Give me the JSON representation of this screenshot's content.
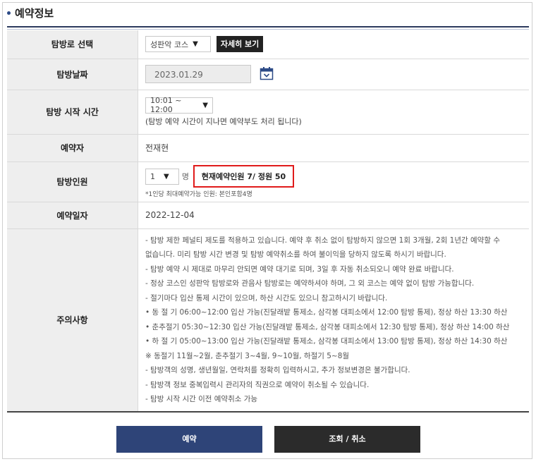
{
  "section_title": "예약정보",
  "rows": {
    "route": {
      "label": "탐방로 선택",
      "select_value": "성판악 코스",
      "detail_button": "자세히 보기"
    },
    "date": {
      "label": "탐방날짜",
      "value": "2023.01.29"
    },
    "start_time": {
      "label": "탐방 시작 시간",
      "select_value": "10:01 ~ 12:00",
      "note": "(탐방 예약 시간이 지나면 예약부도 처리 됩니다)"
    },
    "reserver": {
      "label": "예약자",
      "value": "전재현"
    },
    "people": {
      "label": "탐방인원",
      "select_value": "1",
      "unit": "명",
      "capacity": "현재예약인원 7/ 정원 50",
      "hint": "*1인당 최대예약가능 인원: 본인포함4명"
    },
    "reserve_date": {
      "label": "예약일자",
      "value": "2022-12-04"
    },
    "notes": {
      "label": "주의사항",
      "items": [
        "- 탐방 제한 페널티 제도를 적용하고 있습니다. 예약 후 취소 없이 탐방하지 않으면 1회 3개월, 2회 1년간 예약할 수",
        "  없습니다. 미리 탐방 시간 변경 및 탐방 예약취소를 하여 불이익을 당하지 않도록 하시기 바랍니다.",
        "- 탐방 예약 시 제대로 마무리 안되면 예약 대기로 되며, 3일 후 자동 취소되오니 예약 완료 바랍니다.",
        "- 정상 코스인 성판악 탐방로와 관음사 탐방로는 예약하셔야 하며, 그 외 코스는 예약 없이 탐방 가능합니다.",
        "- 절기마다 입산 통제 시간이 있으며, 하산 시간도 있으니 참고하시기 바랍니다.",
        "  • 동 절 기 06:00~12:00 입산 가능(진달래밭 통제소, 삼각봉 대피소에서 12:00 탐방 통제), 정상 하산 13:30 하산",
        "  • 춘추절기 05:30~12:30 입산 가능(진달래밭 통제소, 삼각봉 대피소에서 12:30 탐방 통제), 정상 하산 14:00 하산",
        "  • 하 절 기 05:00~13:00 입산 가능(진달래밭 통제소, 삼각봉 대피소에서 13:00 탐방 통제), 정상 하산 14:30 하산",
        "  ※ 동절기 11월~2월, 춘추절기 3~4월, 9~10월, 하절기 5~8월",
        "- 탐방객의 성명, 생년월일, 연락처를 정확히 입력하시고, 추가 정보변경은 불가합니다.",
        "- 탐방객 정보 중복입력시 관리자의 직권으로 예약이 취소될 수 있습니다.",
        "- 탐방 시작 시간 이전 예약취소 가능"
      ]
    }
  },
  "buttons": {
    "reserve": "예약",
    "inquiry": "조회 / 취소"
  }
}
